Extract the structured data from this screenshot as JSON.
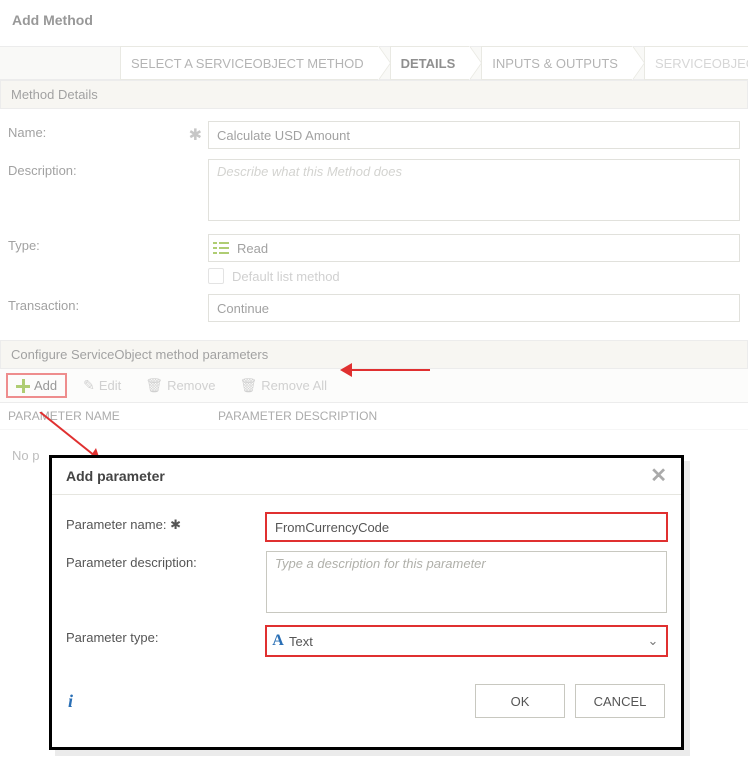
{
  "header": {
    "title": "Add Method"
  },
  "steps": {
    "items": [
      {
        "label": "SELECT A SERVICEOBJECT METHOD"
      },
      {
        "label": "DETAILS"
      },
      {
        "label": "INPUTS & OUTPUTS"
      },
      {
        "label": "SERVICEOBJECT METH"
      }
    ]
  },
  "sections": {
    "details": "Method Details",
    "params": "Configure ServiceObject method parameters"
  },
  "labels": {
    "name": "Name:",
    "description": "Description:",
    "type": "Type:",
    "default_list": "Default list method",
    "transaction": "Transaction:"
  },
  "fields": {
    "name_value": "Calculate USD Amount",
    "desc_placeholder": "Describe what this Method does",
    "type_value": "Read",
    "transaction_value": "Continue"
  },
  "params_toolbar": {
    "add": "Add",
    "edit": "Edit",
    "remove": "Remove",
    "remove_all": "Remove All"
  },
  "params_columns": {
    "name": "PARAMETER NAME",
    "desc": "PARAMETER DESCRIPTION"
  },
  "params_empty": "No p",
  "modal": {
    "title": "Add parameter",
    "name_label": "Parameter name:",
    "name_value": "FromCurrencyCode",
    "desc_label": "Parameter description:",
    "desc_placeholder": "Type a description for this parameter",
    "type_label": "Parameter type:",
    "type_value": "Text",
    "ok": "OK",
    "cancel": "CANCEL"
  }
}
